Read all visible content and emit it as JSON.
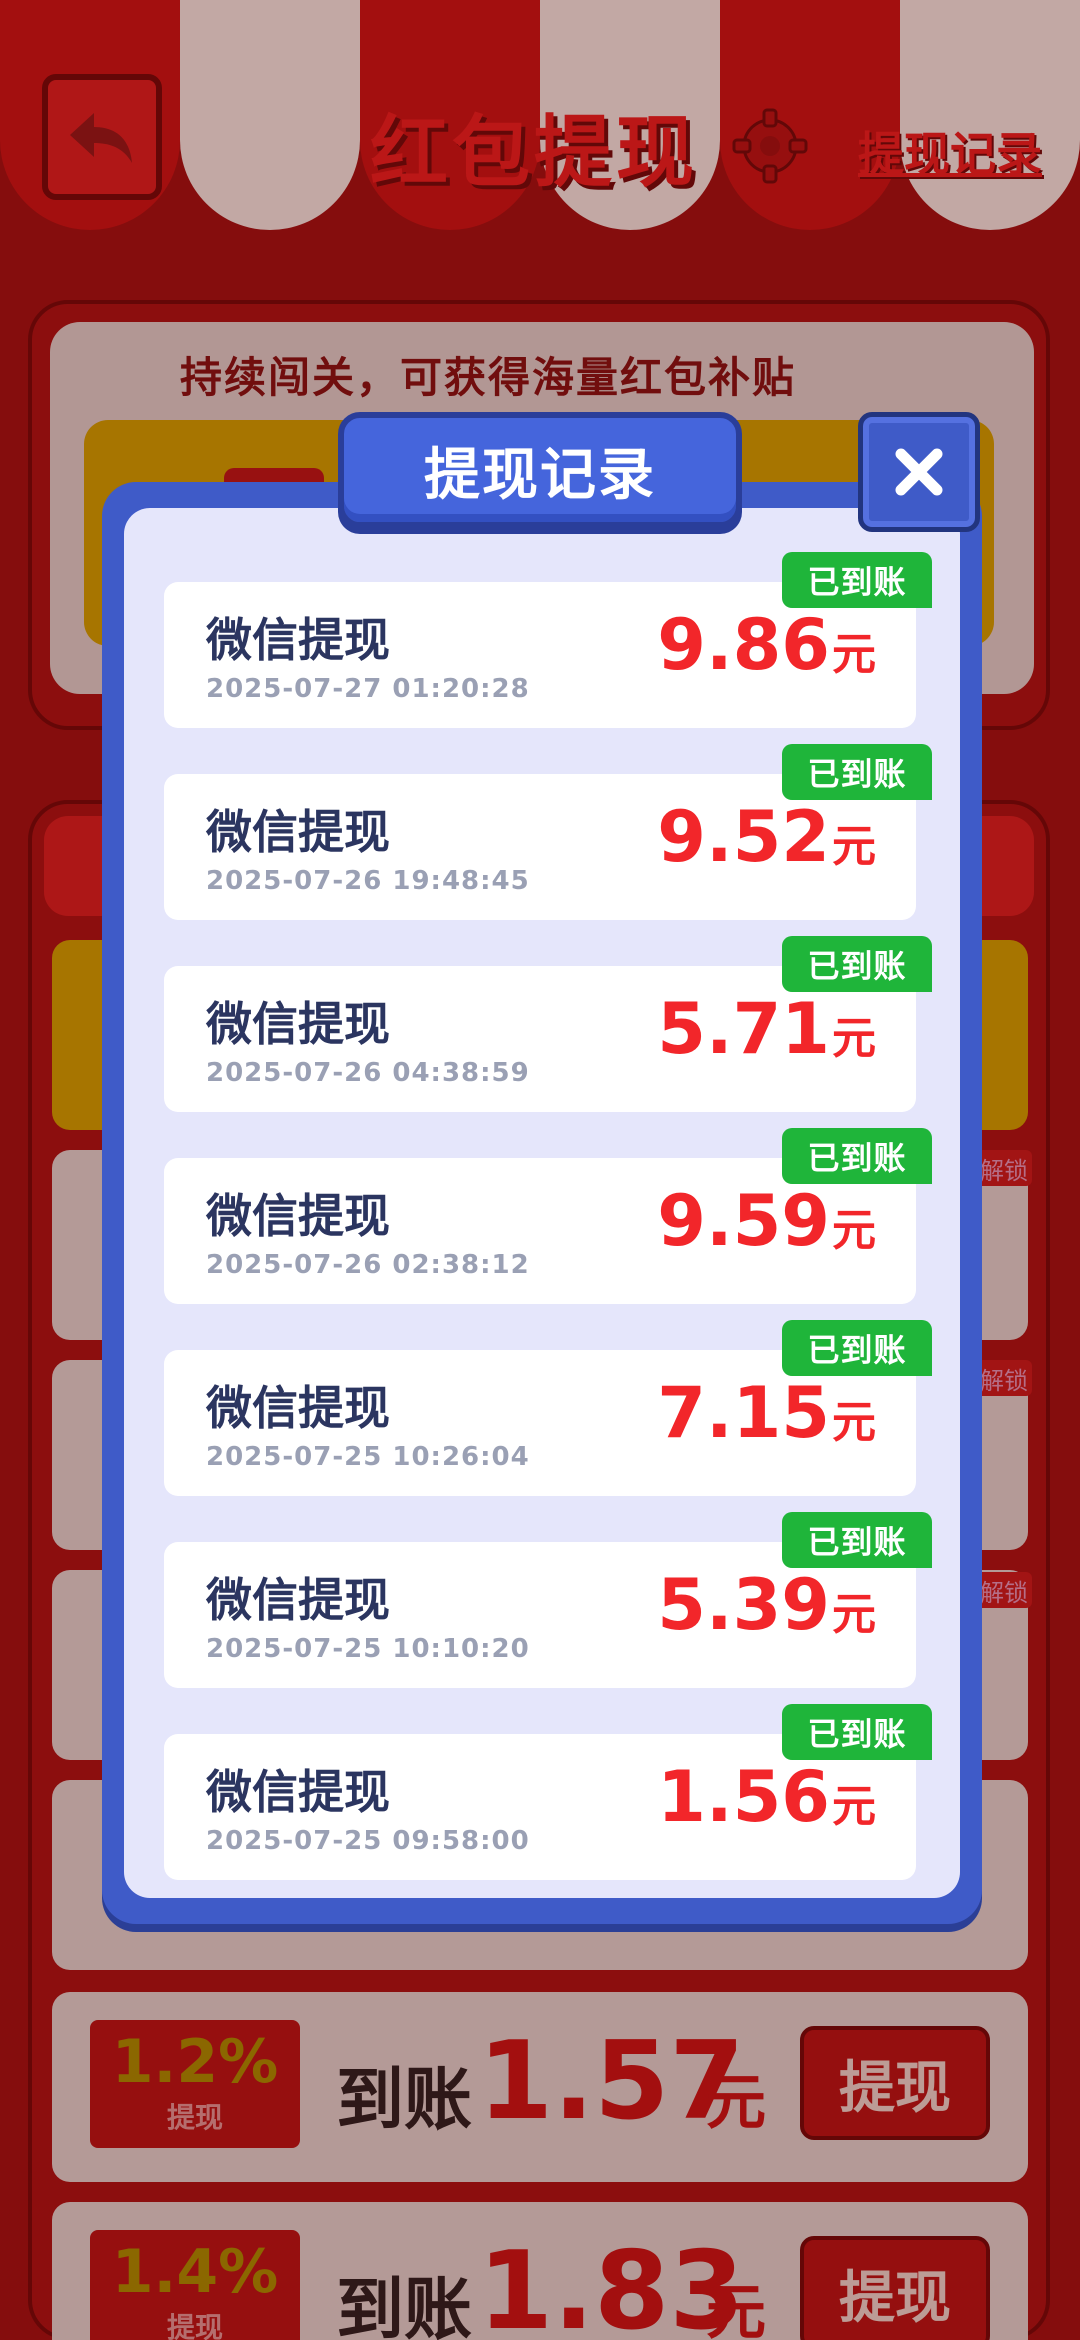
{
  "header": {
    "title": "红包提现",
    "records_link": "提现记录"
  },
  "banner": {
    "text": "持续闯关，可获得海量红包补贴"
  },
  "background_rows": [
    {
      "pct": "1.2%",
      "sub": "提现",
      "label": "到账",
      "amount": "1.57",
      "unit": "元",
      "button": "提现"
    },
    {
      "pct": "1.4%",
      "sub": "提现",
      "label": "到账",
      "amount": "1.83",
      "unit": "元",
      "button": "提现"
    }
  ],
  "unlock_tag": "解锁",
  "modal": {
    "title": "提现记录",
    "records": [
      {
        "title": "微信提现",
        "time": "2025-07-27 01:20:28",
        "amount": "9.86",
        "unit": "元",
        "status": "已到账"
      },
      {
        "title": "微信提现",
        "time": "2025-07-26 19:48:45",
        "amount": "9.52",
        "unit": "元",
        "status": "已到账"
      },
      {
        "title": "微信提现",
        "time": "2025-07-26 04:38:59",
        "amount": "5.71",
        "unit": "元",
        "status": "已到账"
      },
      {
        "title": "微信提现",
        "time": "2025-07-26 02:38:12",
        "amount": "9.59",
        "unit": "元",
        "status": "已到账"
      },
      {
        "title": "微信提现",
        "time": "2025-07-25 10:26:04",
        "amount": "7.15",
        "unit": "元",
        "status": "已到账"
      },
      {
        "title": "微信提现",
        "time": "2025-07-25 10:10:20",
        "amount": "5.39",
        "unit": "元",
        "status": "已到账"
      },
      {
        "title": "微信提现",
        "time": "2025-07-25 09:58:00",
        "amount": "1.56",
        "unit": "元",
        "status": "已到账"
      }
    ]
  },
  "colors": {
    "accent_red": "#f2262a",
    "modal_blue": "#3f5bc8",
    "status_green": "#1fb53a"
  },
  "icons": {
    "back": "back-arrow-icon",
    "settings": "gear-icon",
    "close": "close-icon"
  }
}
